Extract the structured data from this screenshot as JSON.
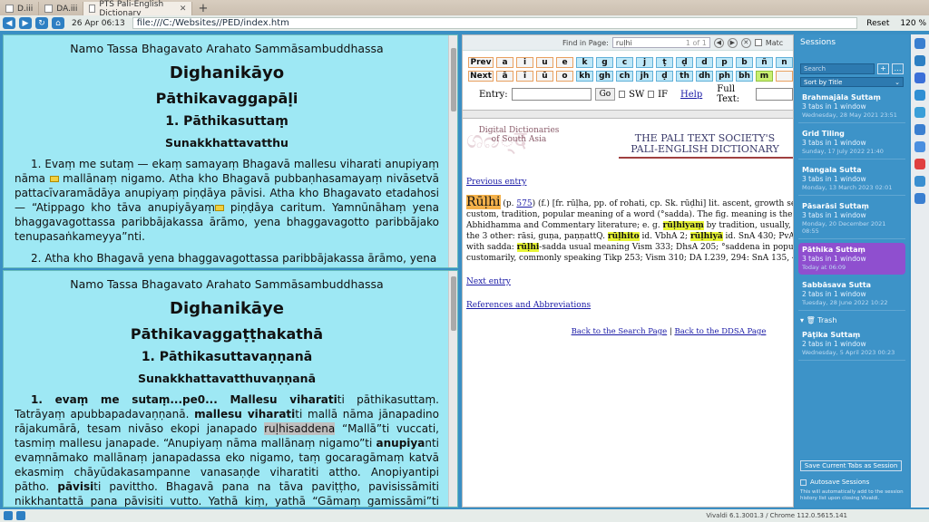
{
  "tabs": [
    {
      "label": "D.iii"
    },
    {
      "label": "DA.iii"
    },
    {
      "label": "PTS Pali-English Dictionary",
      "active": true
    }
  ],
  "address": {
    "date": "26 Apr 06:13",
    "url": "file:///C:/Websites//PED/index.htm",
    "reset": "Reset",
    "zoom": "120 %"
  },
  "pane_top": {
    "namo": "Namo Tassa Bhagavato Arahato Sammāsambuddhassa",
    "title": "Dighanikāyo",
    "vagga": "Pāthikavaggapāḷi",
    "sutta": "1. Pāthikasuttaṃ",
    "section": "Sunakkhattavatthu",
    "para1_a": "1. Evaṃ me sutaṃ — ekaṃ samayaṃ Bhagavā mallesu viharati anupiyaṃ nāma ",
    "para1_b": " mallānaṃ nigamo. Atha kho Bhagavā pubbaṇhasamayaṃ nivāsetvā pattacīvaramādāya anupiyaṃ piṇḍāya pāvisi. Atha kho Bhagavato etadahosi — “Atippago kho tāva anupiyāyaṃ",
    "para1_c": " piṇḍāya caritum. Yamnūnāhaṃ yena bhaggavagottassa paribbājakassa ārāmo, yena bhaggavagotto paribbājako tenupasaṅkameyya”nti.",
    "para2": "2. Atha kho Bhagavā yena bhaggavagottassa paribbājakassa ārāmo, yena"
  },
  "pane_bottom": {
    "namo": "Namo Tassa Bhagavato Arahato Sammāsambuddhassa",
    "title": "Dighanikāye",
    "vagga": "Pāthikavaggaṭṭhakathā",
    "sutta": "1. Pāthikasuttavaṇṇanā",
    "section": "Sunakkhattavatthuvaṇṇanā",
    "p_bold1": "1. evaṃ me sutaṃ...pe0... Mallesu viharati",
    "p_t1": "ti pāthikasuttaṃ. Tatrāyaṃ apubbapadavaṇṇanā. ",
    "p_bold2": "mallesu viharati",
    "p_t2": "ti mallā nāma jānapadino rājakumārā, tesam nivāso ekopi janapado ",
    "p_hl": "ruḷhisaddena",
    "p_t3": " “Mallā”ti vuccati, tasmiṃ mallesu janapade. “Anupiyaṃ nāma mallānaṃ nigamo”ti ",
    "p_bold3": "anupiya",
    "p_t4": "nti evaṃnāmako mallānaṃ janapadassa eko nigamo, taṃ gocaragāmaṃ katvā ekasmiṃ chāyūdakasampanne vanasaṇḍe viharatiti attho. Anopiyantipi pātho. ",
    "p_bold4": "pāvisi",
    "p_t5": "ti pavittho. Bhagavā pana na tāva paviṭṭho, pavisissāmiti nikkhantattā pana pāvisiti vutto. Yathā kiṃ, yathā “Gāmaṃ gamissāmi”ti nikkhanto puriso taṃ gāmaṃ apattopi “Kuhim ittham gāmo”ti"
  },
  "find": {
    "label": "Find in Page:",
    "query": "ruḷhi",
    "count": "1 of 1",
    "match": "Matc"
  },
  "letters": {
    "row1": [
      "Prev",
      "a",
      "i",
      "u",
      "e",
      "k",
      "g",
      "c",
      "j",
      "ṭ",
      "ḍ",
      "d",
      "p",
      "b",
      "ñ",
      "n"
    ],
    "row2": [
      "Next",
      "ā",
      "ī",
      "ū",
      "o",
      "kh",
      "gh",
      "ch",
      "jh",
      "ḍ",
      "th",
      "dh",
      "ph",
      "bh",
      "m",
      ""
    ]
  },
  "entry": {
    "label": "Entry:",
    "go": "Go",
    "sw": "SW",
    "if": "IF",
    "help": "Help",
    "fulltext": "Full Text:"
  },
  "banner": {
    "dda": "Digital Dictionaries of South Asia",
    "pts1": "THE PALI TEXT SOCIETY'S",
    "pts2": "PALI-ENGLISH DICTIONARY"
  },
  "dict": {
    "prev": "Previous entry",
    "headword": "Rūḷhi",
    "page_pre": " (p. ",
    "page": "575",
    "line1_rest": ") (f.) [fr. rūḷha, pp. of rohati, cp. Sk. rūḍhi] lit. ascent, growth see vī°. - f",
    "line2": "custom, tradition, popular meaning of a word (°sadda). The fig. meaning is the one usual",
    "line3_a": "Abhidhamma and Commentary literature; e. g. ",
    "line3_hl": "rūḷhiyaṃ",
    "line3_b": " by tradition, usually, common",
    "line4_a": "the 3 other: rāsi, guṇa, paṇṇattQ. ",
    "line4_hl": "rūḷhito",
    "line4_b": " id. VbhA 2; ",
    "line4_hl2": "rūḷhiyā",
    "line4_c": " id. SnA 430; PvA 163; als",
    "line5_a": "with sadda: ",
    "line5_hl": "rūḷhi",
    "line5_b": "-sadda usual meaning Vism 333; DhsA 205; °saddena in popular lan",
    "line6": "customarily, commonly speaking Tikp 253; Vism 310; DA I.239, 294: SnA 135, 400.",
    "next": "Next entry",
    "refs": "References and Abbreviations",
    "back_search": "Back to the Search Page",
    "sep": "|",
    "back_ddsa": "Back to the DDSA Page"
  },
  "sessions": {
    "title": "Sessions",
    "search_placeholder": "Search",
    "plus": "+",
    "more": "…",
    "sort": "Sort by Title",
    "items": [
      {
        "name": "Brahmajāla Suttaṃ",
        "count": "3 tabs in 1 window",
        "date": "Wednesday, 28 May 2021 23:51"
      },
      {
        "name": "Grid Tiling",
        "count": "3 tabs in 1 window",
        "date": "Sunday, 17 July 2022 21:40"
      },
      {
        "name": "Mangala Sutta",
        "count": "3 tabs in 1 window",
        "date": "Monday, 13 March 2023 02:01"
      },
      {
        "name": "Pāsarāsi Suttaṃ",
        "count": "3 tabs in 1 window",
        "date": "Monday, 20 December 2021 08:55"
      },
      {
        "name": "Pāthika Suttaṃ",
        "count": "3 tabs in 1 window",
        "date": "Today at 06:09"
      },
      {
        "name": "Sabbāsava Sutta",
        "count": "2 tabs in 1 window",
        "date": "Tuesday, 28 June 2022 10:22"
      }
    ],
    "trash_label": "Trash",
    "trash_item": {
      "name": "Pāṭika Suttaṃ",
      "count": "2 tabs in 1 window",
      "date": "Wednesday, 5 April 2023 00:23"
    },
    "save_btn": "Save Current Tabs as Session",
    "autosave": "Autosave Sessions",
    "autosave_note": "This will automatically add to the session history list upon closing Vivaldi."
  },
  "status": {
    "version": "Vivaldi 6.1.3001.3 / Chrome 112.0.5615.141"
  }
}
